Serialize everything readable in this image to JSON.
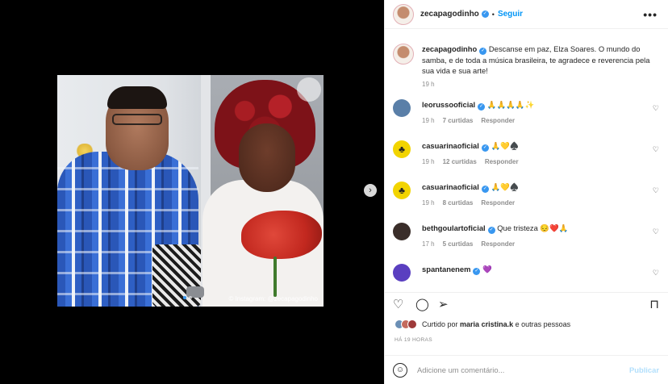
{
  "post": {
    "author": "zecapagodinho",
    "follow_label": "Seguir",
    "separator": "•",
    "more_label": "•••",
    "photo_credit": "© Instagram: @zecapagodinho",
    "carousel_dots": 2,
    "carousel_active": 0
  },
  "caption": {
    "user": "zecapagodinho",
    "text": "Descanse em paz, Elza Soares. O mundo do samba, e de toda a música brasileira, te agradece e reverencia pela sua vida e sua arte!",
    "time": "19 h"
  },
  "comments": [
    {
      "user": "leorussooficial",
      "text": "🙏🙏🙏🙏✨",
      "time": "19 h",
      "likes": "7 curtidas",
      "reply": "Responder",
      "avatar_color": "#5a7fa8"
    },
    {
      "user": "casuarinaoficial",
      "text": "🙏💛♠️",
      "time": "19 h",
      "likes": "12 curtidas",
      "reply": "Responder",
      "avatar_color": "#f2d400"
    },
    {
      "user": "casuarinaoficial",
      "text": "🙏💛♠️",
      "time": "19 h",
      "likes": "8 curtidas",
      "reply": "Responder",
      "avatar_color": "#f2d400"
    },
    {
      "user": "bethgoulartoficial",
      "text": "Que tristeza 😔❤️🙏",
      "time": "17 h",
      "likes": "5 curtidas",
      "reply": "Responder",
      "avatar_color": "#3a2e2a"
    },
    {
      "user": "spantanenem",
      "text": "💜",
      "time": "",
      "likes": "",
      "reply": "",
      "avatar_color": "#5a3fc0"
    }
  ],
  "likes": {
    "prefix": "Curtido por",
    "user": "maria cristina.k",
    "suffix": "e outras pessoas"
  },
  "timestamp": "HÁ 19 HORAS",
  "add_comment": {
    "placeholder": "Adicione um comentário...",
    "publish_label": "Publicar"
  },
  "colors": {
    "accent": "#0095f6",
    "verified": "#3897f0"
  }
}
